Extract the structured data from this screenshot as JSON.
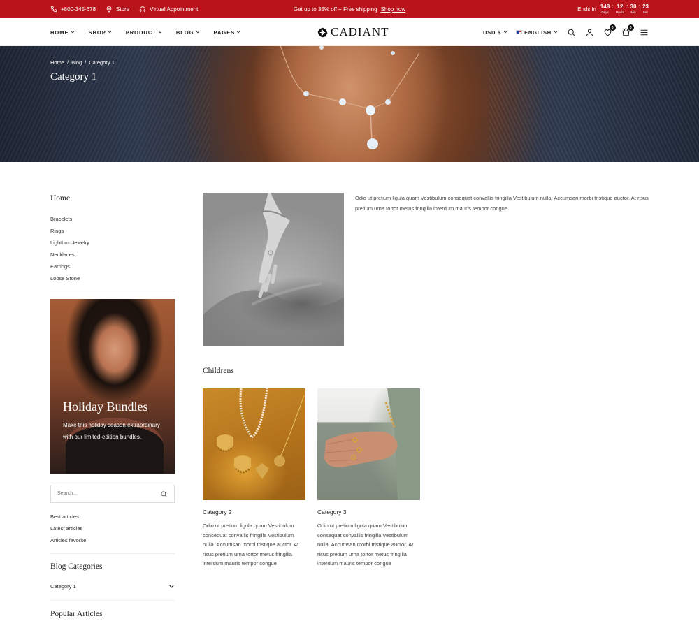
{
  "topbar": {
    "phone": "+800-345-678",
    "store": "Store",
    "appointment": "Virtual Appointment",
    "promo": "Get up to 35% off + Free shipping",
    "promo_link": "Shop now",
    "ends_in": "Ends in",
    "countdown": [
      {
        "value": "148",
        "label": "Days"
      },
      {
        "value": "12",
        "label": "Hours"
      },
      {
        "value": "30",
        "label": "Min"
      },
      {
        "value": "23",
        "label": "Sec"
      }
    ]
  },
  "header": {
    "nav": [
      "HOME",
      "SHOP",
      "PRODUCT",
      "BLOG",
      "PAGES"
    ],
    "logo": "CADIANT",
    "currency": "USD $",
    "language": "ENGLISH",
    "wishlist_count": "0",
    "cart_count": "0"
  },
  "hero": {
    "breadcrumb": [
      "Home",
      "/",
      "Blog",
      "/",
      "Category 1"
    ],
    "title": "Category 1"
  },
  "sidebar": {
    "home_heading": "Home",
    "menu": [
      "Bracelets",
      "Rings",
      "Lightbox Jewelry",
      "Necklaces",
      "Earrings",
      "Loose Stone"
    ],
    "promo": {
      "title": "Holiday Bundles",
      "text": "Make this holiday season extraordinary with our limited-edition bundles."
    },
    "search_placeholder": "Search...",
    "article_links": [
      "Best articles",
      "Latest articles",
      "Articles favorite"
    ],
    "blog_categories_heading": "Blog Categories",
    "blog_category": "Category 1",
    "popular_heading": "Popular Articles"
  },
  "main": {
    "intro": "Odio ut pretium ligula quam Vestibulum consequat convallis fringilla Vestibulum nulla. Accumsan morbi tristique auctor. At risus pretium urna tortor metus fringilla interdum mauris tempor congue",
    "childrens_heading": "Childrens",
    "children": [
      {
        "title": "Category 2",
        "desc": "Odio ut pretium ligula quam Vestibulum consequat convallis fringilla Vestibulum nulla. Accumsan morbi tristique auctor. At risus pretium urna tortor metus fringilla interdum mauris tempor congue"
      },
      {
        "title": "Category 3",
        "desc": "Odio ut pretium ligula quam Vestibulum consequat convallis fringilla Vestibulum nulla. Accumsan morbi tristique auctor. At risus pretium urna tortor metus fringilla interdum mauris tempor congue"
      }
    ]
  },
  "colors": {
    "topbar_bg": "#b9141b",
    "text_dark": "#222222",
    "border": "#eeeeee"
  },
  "icons": [
    "phone-icon",
    "location-icon",
    "headphones-icon",
    "search-icon",
    "user-icon",
    "heart-icon",
    "cart-icon",
    "menu-icon",
    "chevron-down-icon",
    "logo-icon"
  ]
}
